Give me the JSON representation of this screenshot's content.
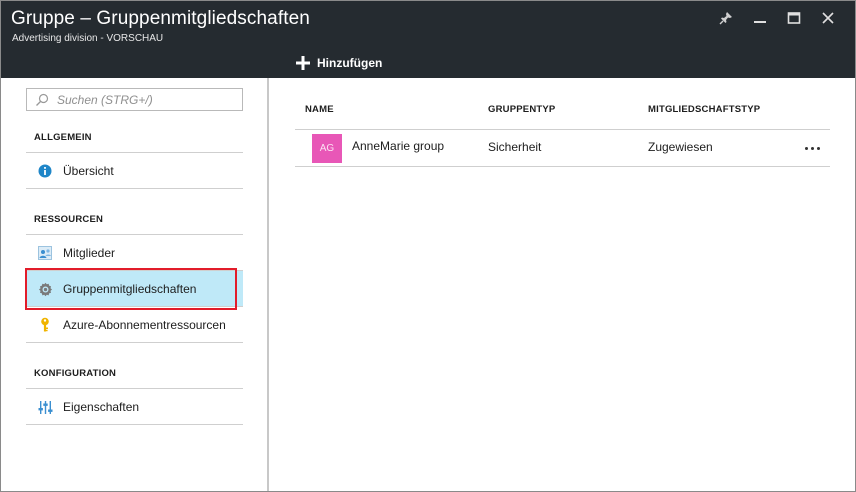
{
  "header": {
    "title": "Gruppe – Gruppenmitgliedschaften",
    "subtitle": "Advertising division - VORSCHAU",
    "controls": [
      "pin-icon",
      "minimize-icon",
      "maximize-icon",
      "close-icon"
    ],
    "background": "#252b30"
  },
  "commandbar": {
    "add_label": "Hinzufügen"
  },
  "sidebar": {
    "search": {
      "placeholder": "Suchen (STRG+/)",
      "value": ""
    },
    "sections": [
      {
        "title": "ALLGEMEIN",
        "items": [
          {
            "label": "Übersicht",
            "icon": "info-icon"
          }
        ]
      },
      {
        "title": "RESSOURCEN",
        "items": [
          {
            "label": "Mitglieder",
            "icon": "members-icon"
          },
          {
            "label": "Gruppenmitgliedschaften",
            "icon": "gear-icon",
            "selected": true
          },
          {
            "label": "Azure-Abonnementressourcen",
            "icon": "key-icon"
          }
        ]
      },
      {
        "title": "KONFIGURATION",
        "items": [
          {
            "label": "Eigenschaften",
            "icon": "sliders-icon"
          }
        ]
      }
    ],
    "selected_color": "#bfe9f8",
    "highlight_color": "#e21c2a"
  },
  "table": {
    "columns": [
      "NAME",
      "GRUPPENTYP",
      "MITGLIEDSCHAFTSTYP"
    ],
    "rows": [
      {
        "avatar_initials": "AG",
        "avatar_color": "#e857b7",
        "name": "AnneMarie group",
        "group_type": "Sicherheit",
        "membership_type": "Zugewiesen"
      }
    ]
  }
}
